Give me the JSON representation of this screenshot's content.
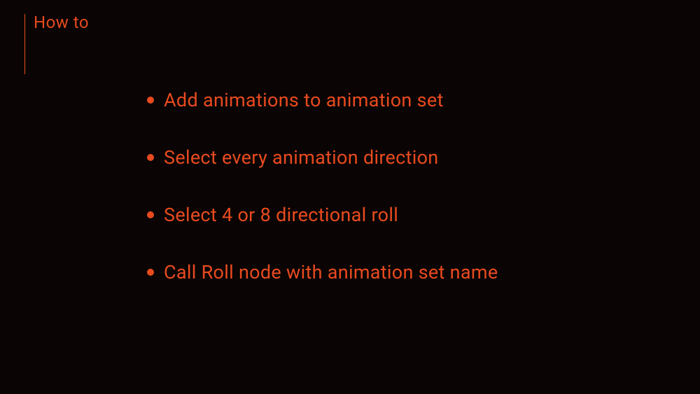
{
  "slide": {
    "title": "How to",
    "bullets": [
      "Add animations to animation set",
      "Select every animation direction",
      "Select 4 or 8 directional roll",
      "Call Roll node with animation set name"
    ]
  }
}
